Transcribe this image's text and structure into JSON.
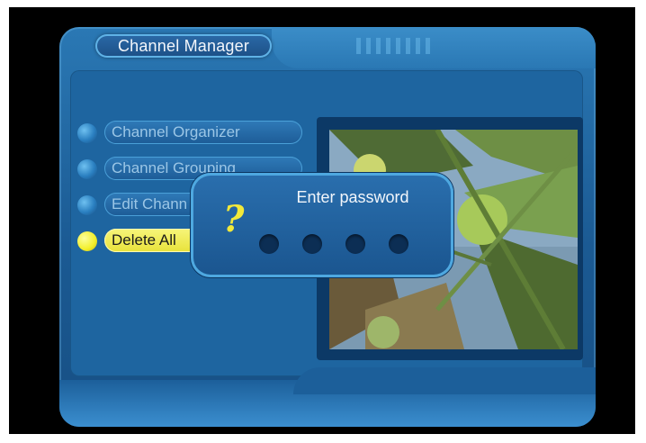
{
  "header": {
    "title": "Channel Manager"
  },
  "menu": {
    "items": [
      {
        "label": "Channel Organizer",
        "active": false
      },
      {
        "label": "Channel Grouping",
        "active": false
      },
      {
        "label": "Edit Chann",
        "active": false
      },
      {
        "label": "Delete All",
        "active": true
      }
    ]
  },
  "dialog": {
    "icon": "?",
    "title": "Enter password",
    "digits": 4
  },
  "colors": {
    "panel": "#1e65a0",
    "highlight": "#f3ef2a",
    "dialog": "#2a6fae"
  }
}
